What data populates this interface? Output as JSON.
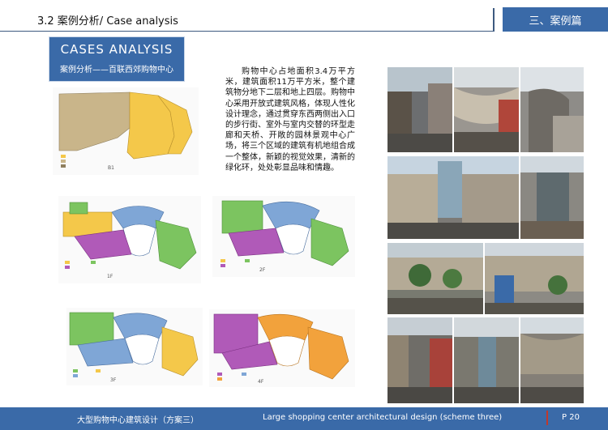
{
  "header": {
    "section_title": "3.2  案例分析/ Case analysis",
    "chapter_tab": "三、案例篇"
  },
  "cases_box": {
    "title": "CASES   ANALYSIS",
    "subtitle": "案例分析——百联西郊购物中心"
  },
  "description": "购物中心占地面积3.4万平方米，建筑面积11万平方米，整个建筑物分地下二层和地上四层。购物中心采用开放式建筑风格，体现人性化设计理念，通过贯穿东西两侧出入口的步行街、室外与室内交替的环型走廊和天桥、开敞的园林景观中心广场，将三个区域的建筑有机地组合成一个整体，新颖的视觉效果，清新的绿化环，处处彰显品味和情趣。",
  "plans": {
    "b1_label": "B1",
    "f1_label": "1F",
    "f2_label": "2F",
    "f3_label": "3F",
    "f4_label": "4F"
  },
  "footer": {
    "title_cn": "大型购物中心建筑设计（方案三）",
    "title_en": "Large shopping center architectural design (scheme three)",
    "page": "P  20"
  },
  "colors": {
    "accent_blue": "#3a6aa8",
    "footer_mark": "#c0392b",
    "plan_yellow": "#f4c84a",
    "plan_green": "#7cc460",
    "plan_purple": "#b05ab8",
    "plan_blue": "#7fa6d6",
    "plan_orange": "#f2a23c",
    "plan_tan": "#c9b58a"
  }
}
